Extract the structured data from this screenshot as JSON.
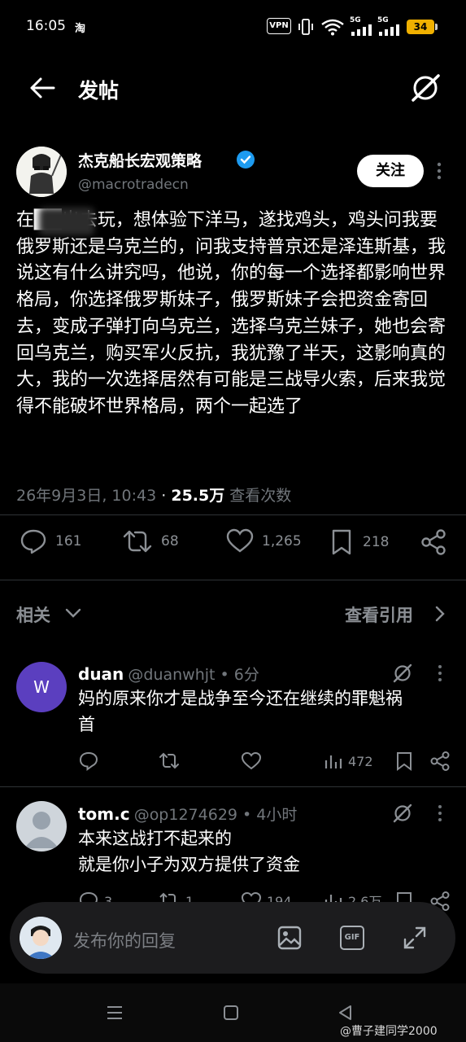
{
  "status_bar": {
    "time": "16:05",
    "app_badge": "淘",
    "vpn": "VPN",
    "net1": "5G",
    "net2": "5G",
    "battery": "34"
  },
  "header": {
    "title": "发帖"
  },
  "post": {
    "author_name": "杰克船长宏观策略",
    "author_handle": "@macrotradecn",
    "follow_label": "关注",
    "text": "在██出去玩，想体验下洋马，遂找鸡头，鸡头问我要俄罗斯还是乌克兰的，问我支持普京还是泽连斯基，我说这有什么讲究吗，他说，你的每一个选择都影响世界格局，你选择俄罗斯妹子，俄罗斯妹子会把资金寄回去，变成子弹打向乌克兰，选择乌克兰妹子，她也会寄回乌克兰，购买军火反抗，我犹豫了半天，这影响真的大，我的一次选择居然有可能是三战导火索，后来我觉得不能破坏世界格局，两个一起选了",
    "date": "26年9月3日, 10:43",
    "dot": "·",
    "views_count": "25.5万",
    "views_label": "查看次数",
    "replies": "161",
    "retweets": "68",
    "likes": "1,265",
    "bookmarks": "218"
  },
  "related": {
    "label": "相关",
    "quotes_label": "查看引用"
  },
  "replies": [
    {
      "avatar_letter": "W",
      "avatar_color": "#5b3fbf",
      "name": "duan",
      "meta": "@duanwhjt • 6分",
      "text_line1": "妈的原来你才是战争至今还在继续的罪魁祸",
      "text_line2": "首",
      "views": "472"
    },
    {
      "name": "tom.c",
      "meta": "@op1274629 • 4小时",
      "text_line1": "本来这战打不起来的",
      "text_line2": "就是你小子为双方提供了资金",
      "comments": "3",
      "retweets": "1",
      "likes": "194",
      "views": "2.6万"
    }
  ],
  "reply_bar": {
    "placeholder": "发布你的回复",
    "gif_label": "GIF"
  },
  "watermark": "@曹子建同学2000"
}
